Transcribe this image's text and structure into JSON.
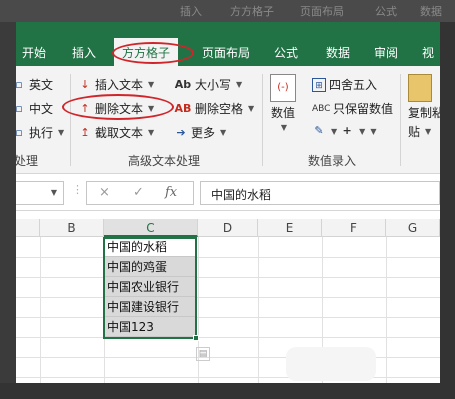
{
  "background_tabs": [
    "插入",
    "方方格子",
    "页面布局",
    "公式",
    "数据"
  ],
  "tabs": [
    {
      "label": "开始",
      "active": false
    },
    {
      "label": "插入",
      "active": false
    },
    {
      "label": "方方格子",
      "active": true
    },
    {
      "label": "页面布局",
      "active": false
    },
    {
      "label": "公式",
      "active": false
    },
    {
      "label": "数据",
      "active": false
    },
    {
      "label": "审阅",
      "active": false
    },
    {
      "label": "视",
      "active": false
    }
  ],
  "ribbon": {
    "left_partial": [
      "英文",
      "中文",
      "执行"
    ],
    "left_group_label": "处理",
    "text_group": {
      "insert_text": "插入文本",
      "delete_text": "删除文本",
      "extract_text": "截取文本",
      "case": "大小写",
      "delete_spaces": "删除空格",
      "more": "更多",
      "label": "高级文本处理"
    },
    "number_group": {
      "value_label": "数值",
      "round": "四舍五入",
      "keep_value": "只保留数值",
      "label": "数值录入"
    },
    "right_partial": {
      "copy": "复制粘",
      "paste": "贴"
    }
  },
  "formula_bar": {
    "name_box": "",
    "cancel_icon": "×",
    "enter_icon": "✓",
    "fx_icon": "fx",
    "value": "中国的水稻"
  },
  "columns": [
    "B",
    "C",
    "D",
    "E",
    "F",
    "G"
  ],
  "selected_column": "C",
  "cells": [
    "中国的水稻",
    "中国的鸡蛋",
    "中国农业银行",
    "中国建设银行",
    "中国123"
  ],
  "colors": {
    "accent": "#217346",
    "annotation": "#d0252a"
  }
}
